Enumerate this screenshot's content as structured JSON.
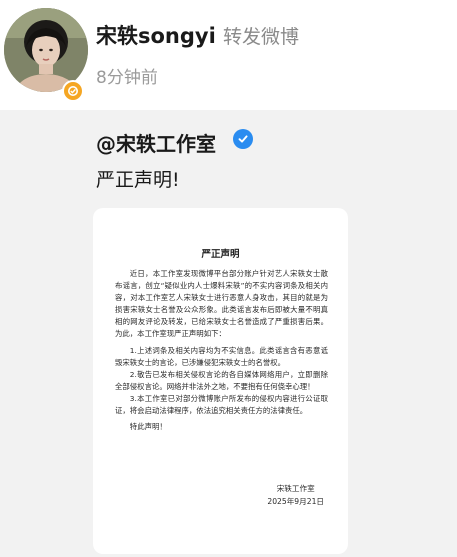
{
  "post": {
    "username": "宋轶songyi",
    "action": "转发微博",
    "time": "8分钟前"
  },
  "quoted": {
    "author": "@宋轶工作室",
    "text": "严正声明!"
  },
  "statement": {
    "title": "严正声明",
    "paragraphs": [
      "近日，本工作室发现微博平台部分账户针对艺人宋轶女士散布谣言，创立“疑似业内人士爆料宋轶”的不实内容词条及相关内容，对本工作室艺人宋轶女士进行恶意人身攻击，其目的就是为损害宋轶女士名誉及公众形象。此类谣言发布后即被大量不明真相的网友评论及转发，已给宋轶女士名誉造成了严重损害后果。为此，本工作室现严正声明如下：",
      "1.上述词条及相关内容均为不实信息。此类谣言含有恶意诋毁宋轶女士的言论，已涉嫌侵犯宋轶女士的名誉权。",
      "2.敬告已发布相关侵权言论的各自媒体网络用户，立即删除全部侵权言论。网络并非法外之地，不要抱有任何侥幸心理！",
      "3.本工作室已对部分微博账户所发布的侵权内容进行公证取证，将会启动法律程序，依法追究相关责任方的法律责任。",
      "特此声明！"
    ],
    "signature": "宋轶工作室",
    "date": "2025年9月21日"
  },
  "colors": {
    "verified_orange": "#f5a623",
    "verified_blue": "#2a8cf0",
    "quote_background": "#f2f2f2"
  }
}
